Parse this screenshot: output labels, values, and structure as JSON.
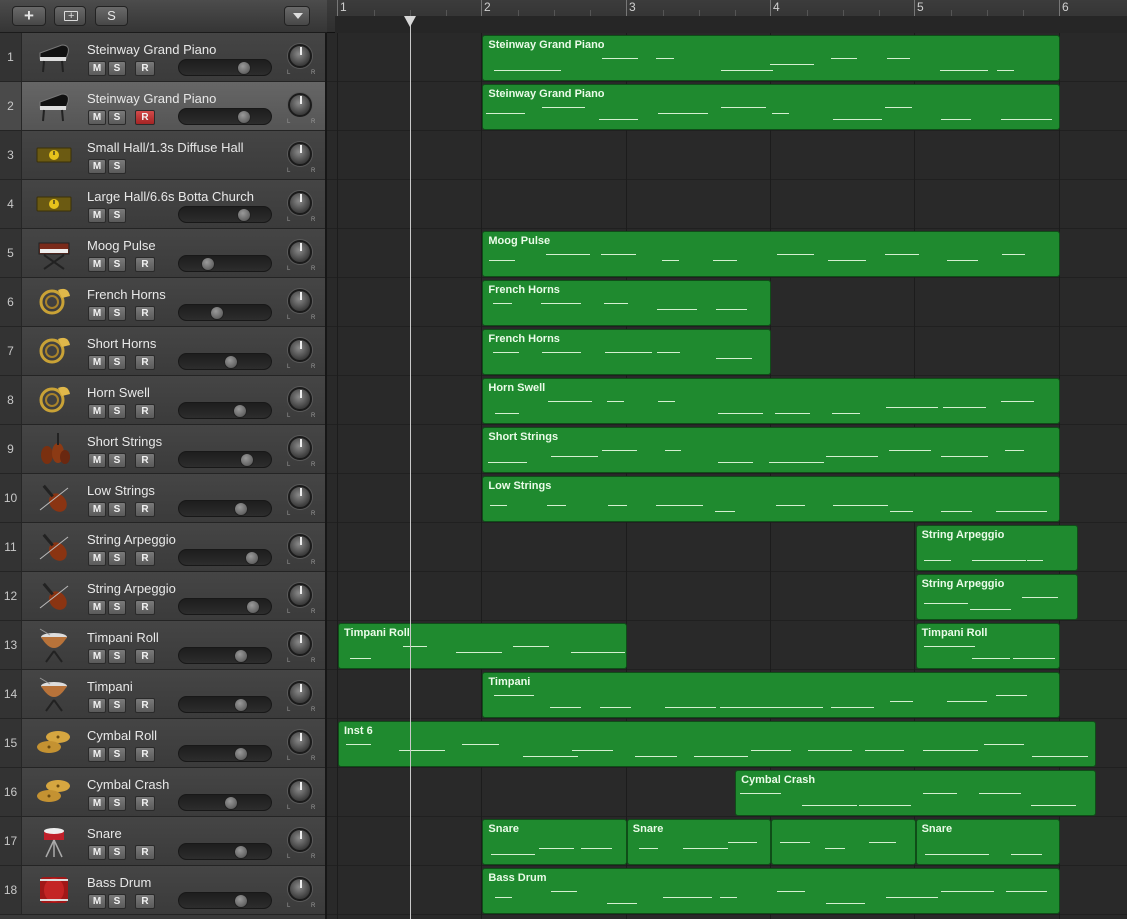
{
  "header": {
    "add_label": "+",
    "solo_label": "S"
  },
  "ruler": {
    "bars": [
      "1",
      "2",
      "3",
      "4",
      "5",
      "6"
    ]
  },
  "tracks": [
    {
      "num": "1",
      "name": "Steinway Grand Piano",
      "icon": "grand-piano-icon",
      "m": "M",
      "s": "S",
      "r": "R",
      "volume": 0.74,
      "selected": false
    },
    {
      "num": "2",
      "name": "Steinway Grand Piano",
      "icon": "grand-piano-icon",
      "m": "M",
      "s": "S",
      "r": "R",
      "volume": 0.74,
      "selected": true,
      "rec_armed": true
    },
    {
      "num": "3",
      "name": "Small Hall/1.3s Diffuse Hall",
      "icon": "aux-channel-icon",
      "m": "M",
      "s": "S"
    },
    {
      "num": "4",
      "name": "Large Hall/6.6s Botta Church",
      "icon": "aux-channel-icon",
      "m": "M",
      "s": "S",
      "volume": 0.74
    },
    {
      "num": "5",
      "name": "Moog Pulse",
      "icon": "synth-keyboard-icon",
      "m": "M",
      "s": "S",
      "r": "R",
      "volume": 0.26
    },
    {
      "num": "6",
      "name": "French Horns",
      "icon": "french-horn-icon",
      "m": "M",
      "s": "S",
      "r": "R",
      "volume": 0.38
    },
    {
      "num": "7",
      "name": "Short Horns",
      "icon": "french-horn-icon",
      "m": "M",
      "s": "S",
      "r": "R",
      "volume": 0.56
    },
    {
      "num": "8",
      "name": "Horn Swell",
      "icon": "french-horn-icon",
      "m": "M",
      "s": "S",
      "r": "R",
      "volume": 0.68
    },
    {
      "num": "9",
      "name": "Short Strings",
      "icon": "strings-section-icon",
      "m": "M",
      "s": "S",
      "r": "R",
      "volume": 0.78
    },
    {
      "num": "10",
      "name": "Low Strings",
      "icon": "violin-icon",
      "m": "M",
      "s": "S",
      "r": "R",
      "volume": 0.7
    },
    {
      "num": "11",
      "name": "String Arpeggio",
      "icon": "violin-icon",
      "m": "M",
      "s": "S",
      "r": "R",
      "volume": 0.84
    },
    {
      "num": "12",
      "name": "String Arpeggio",
      "icon": "violin-icon",
      "m": "M",
      "s": "S",
      "r": "R",
      "volume": 0.86
    },
    {
      "num": "13",
      "name": "Timpani Roll",
      "icon": "timpani-icon",
      "m": "M",
      "s": "S",
      "r": "R",
      "volume": 0.7
    },
    {
      "num": "14",
      "name": "Timpani",
      "icon": "timpani-icon",
      "m": "M",
      "s": "S",
      "r": "R",
      "volume": 0.7
    },
    {
      "num": "15",
      "name": "Cymbal Roll",
      "icon": "cymbal-icon",
      "m": "M",
      "s": "S",
      "r": "R",
      "volume": 0.7
    },
    {
      "num": "16",
      "name": "Cymbal Crash",
      "icon": "cymbal-icon",
      "m": "M",
      "s": "S",
      "r": "R",
      "volume": 0.56
    },
    {
      "num": "17",
      "name": "Snare",
      "icon": "snare-drum-icon",
      "m": "M",
      "s": "S",
      "r": "R",
      "volume": 0.7
    },
    {
      "num": "18",
      "name": "Bass Drum",
      "icon": "bass-drum-icon",
      "m": "M",
      "s": "S",
      "r": "R",
      "volume": 0.7
    }
  ],
  "regions": [
    {
      "track": 1,
      "name": "Steinway Grand Piano",
      "start": 2.0,
      "end": 6.0
    },
    {
      "track": 2,
      "name": "Steinway Grand Piano",
      "start": 2.0,
      "end": 6.0
    },
    {
      "track": 5,
      "name": "Moog Pulse",
      "start": 2.0,
      "end": 6.0
    },
    {
      "track": 6,
      "name": "French Horns",
      "start": 2.0,
      "end": 4.0
    },
    {
      "track": 7,
      "name": "French Horns",
      "start": 2.0,
      "end": 4.0
    },
    {
      "track": 8,
      "name": "Horn Swell",
      "start": 2.0,
      "end": 6.0
    },
    {
      "track": 9,
      "name": "Short Strings",
      "start": 2.0,
      "end": 6.0
    },
    {
      "track": 10,
      "name": "Low Strings",
      "start": 2.0,
      "end": 6.0
    },
    {
      "track": 11,
      "name": "String Arpeggio",
      "start": 5.0,
      "end": 6.125
    },
    {
      "track": 12,
      "name": "String Arpeggio",
      "start": 5.0,
      "end": 6.125
    },
    {
      "track": 13,
      "name": "Timpani Roll",
      "start": 1.0,
      "end": 3.0
    },
    {
      "track": 13,
      "name": "Timpani Roll",
      "start": 5.0,
      "end": 6.0
    },
    {
      "track": 14,
      "name": "Timpani",
      "start": 2.0,
      "end": 6.0
    },
    {
      "track": 15,
      "name": "Inst 6",
      "start": 1.0,
      "end": 6.25
    },
    {
      "track": 16,
      "name": "Cymbal Crash",
      "start": 3.75,
      "end": 6.25
    },
    {
      "track": 17,
      "name": "Snare",
      "start": 2.0,
      "end": 3.0
    },
    {
      "track": 17,
      "name": "Snare",
      "start": 3.0,
      "end": 4.0
    },
    {
      "track": 17,
      "name": "",
      "start": 4.0,
      "end": 5.0
    },
    {
      "track": 17,
      "name": "Snare",
      "start": 5.0,
      "end": 6.0
    },
    {
      "track": 18,
      "name": "Bass Drum",
      "start": 2.0,
      "end": 6.0
    }
  ],
  "playhead_bar": 1.5,
  "colors": {
    "region": "#1f8a2f",
    "record_armed": "#c43a3a"
  }
}
